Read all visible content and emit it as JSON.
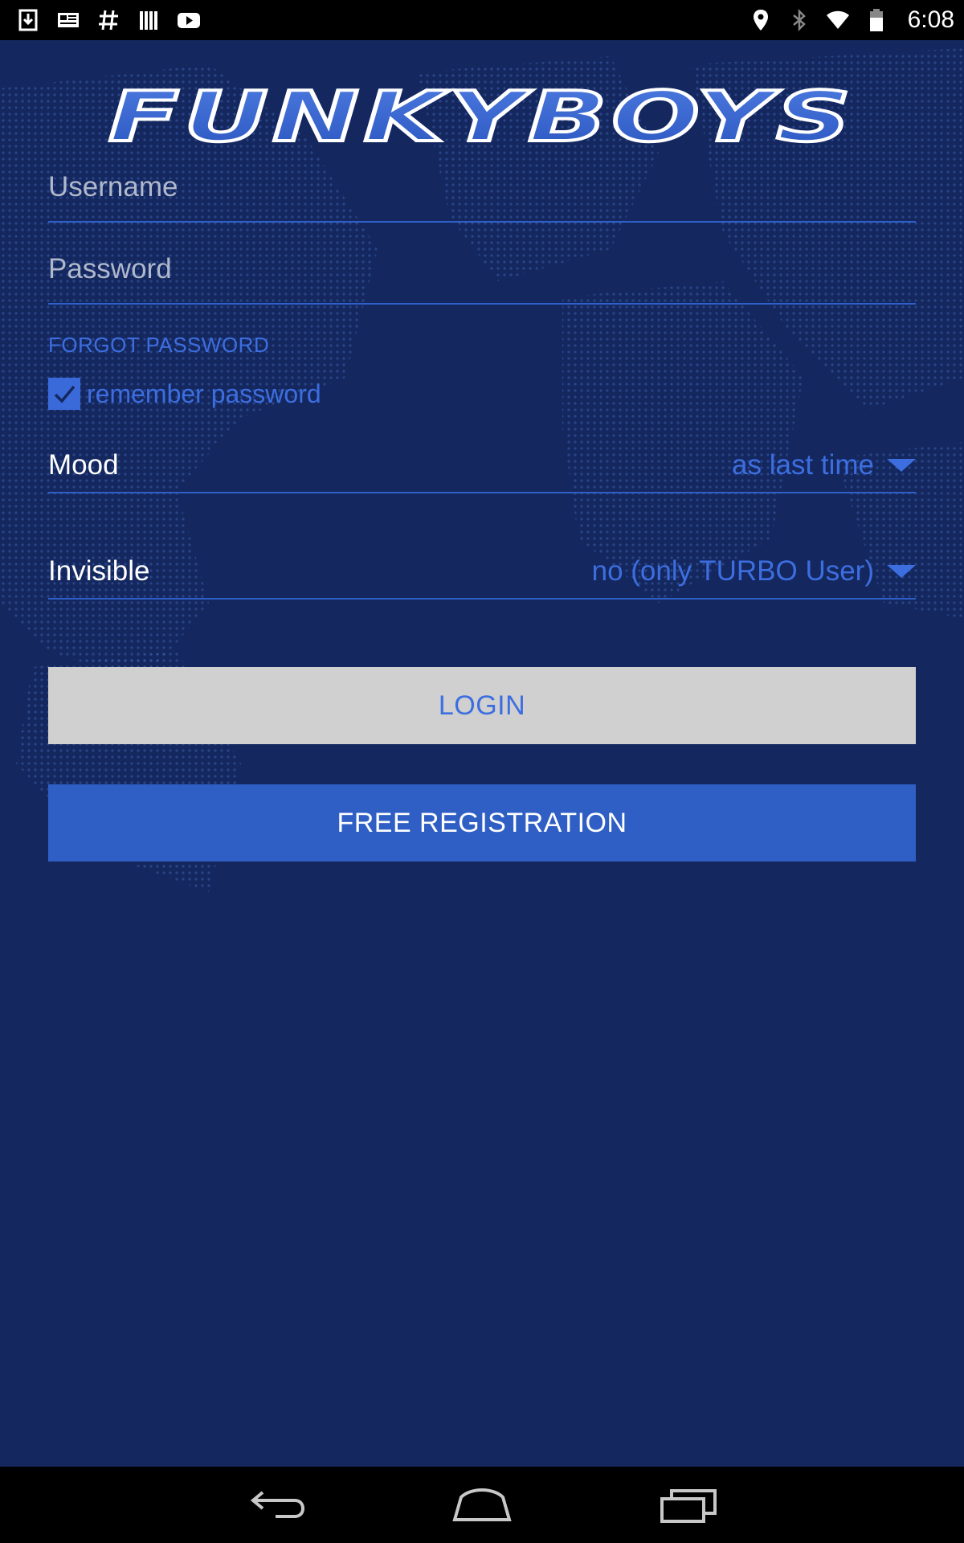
{
  "status_bar": {
    "time": "6:08",
    "left_icons": [
      "download-icon",
      "news-icon",
      "hashtag-icon",
      "library-icon",
      "youtube-icon"
    ],
    "right_icons": [
      "location-icon",
      "bluetooth-icon",
      "wifi-icon",
      "battery-icon"
    ]
  },
  "app": {
    "logo_text": "FUNKYBOYS",
    "colors": {
      "background": "#14285f",
      "accent": "#3d6ee0",
      "register_button": "#2f5fc4",
      "login_button": "#d0d0d0"
    }
  },
  "form": {
    "username": {
      "value": "",
      "placeholder": "Username"
    },
    "password": {
      "value": "",
      "placeholder": "Password"
    },
    "forgot_password_label": "FORGOT PASSWORD",
    "remember_password": {
      "label": "remember password",
      "checked": true
    },
    "mood": {
      "label": "Mood",
      "selected": "as last time"
    },
    "invisible": {
      "label": "Invisible",
      "selected": "no (only TURBO User)"
    },
    "login_label": "LOGIN",
    "register_label": "FREE REGISTRATION"
  },
  "nav_bar": {
    "buttons": [
      "back-icon",
      "home-icon",
      "recent-apps-icon"
    ]
  }
}
